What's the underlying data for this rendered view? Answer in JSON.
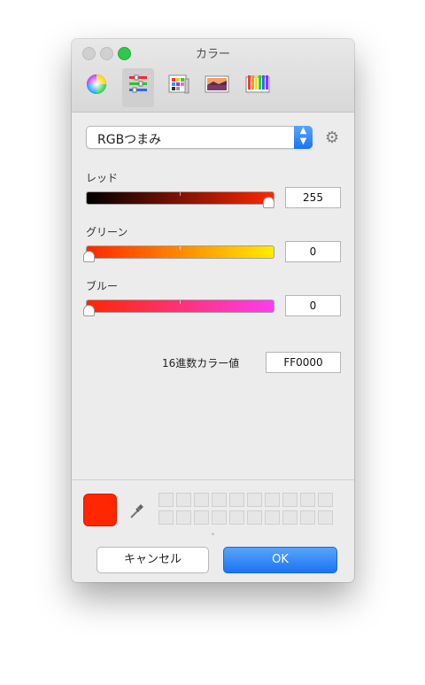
{
  "window": {
    "title": "カラー"
  },
  "toolbar": {
    "tools": [
      {
        "name": "color-wheel"
      },
      {
        "name": "color-sliders",
        "selected": true
      },
      {
        "name": "color-palettes"
      },
      {
        "name": "image-palettes"
      },
      {
        "name": "crayon-picker"
      }
    ]
  },
  "mode": {
    "selected": "RGBつまみ"
  },
  "sliders": {
    "red": {
      "label": "レッド",
      "value": "255"
    },
    "green": {
      "label": "グリーン",
      "value": "0"
    },
    "blue": {
      "label": "ブルー",
      "value": "0"
    }
  },
  "hex": {
    "label": "16進数カラー値",
    "value": "FF0000"
  },
  "current_color": "#ff2600",
  "buttons": {
    "cancel": "キャンセル",
    "ok": "OK"
  }
}
